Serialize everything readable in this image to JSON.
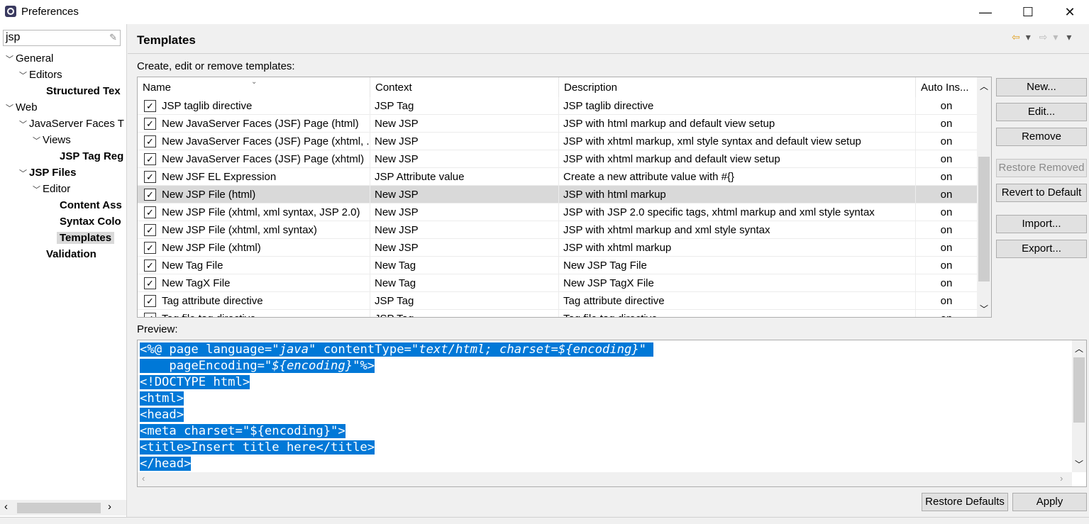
{
  "window": {
    "title": "Preferences",
    "minimize_glyph": "—",
    "maximize_glyph": "☐",
    "close_glyph": "✕"
  },
  "filter": {
    "value": "jsp",
    "clear_icon": "eraser-icon"
  },
  "tree": {
    "general": "General",
    "editors": "Editors",
    "structured_text": "Structured Tex",
    "web": "Web",
    "jsf": "JavaServer Faces T",
    "views": "Views",
    "jsp_tag_reg": "JSP Tag Reg",
    "jsp_files": "JSP Files",
    "editor": "Editor",
    "content_assist": "Content Ass",
    "syntax_coloring": "Syntax Colo",
    "templates": "Templates",
    "validation": "Validation"
  },
  "page": {
    "title": "Templates",
    "subtitle": "Create, edit or remove templates:",
    "preview_label": "Preview:"
  },
  "table": {
    "headers": {
      "name": "Name",
      "context": "Context",
      "description": "Description",
      "auto": "Auto Ins..."
    },
    "rows": [
      {
        "name": "JSP taglib directive",
        "context": "JSP Tag",
        "description": "JSP taglib directive",
        "auto": "on"
      },
      {
        "name": "New JavaServer Faces (JSF) Page (html)",
        "context": "New JSP",
        "description": "JSP with html markup and default view setup",
        "auto": "on"
      },
      {
        "name": "New JavaServer Faces (JSF) Page (xhtml, ...",
        "context": "New JSP",
        "description": "JSP with xhtml markup, xml style syntax and default view setup",
        "auto": "on"
      },
      {
        "name": "New JavaServer Faces (JSF) Page (xhtml)",
        "context": "New JSP",
        "description": "JSP with xhtml markup and default view setup",
        "auto": "on"
      },
      {
        "name": "New JSF EL Expression",
        "context": "JSP Attribute value",
        "description": "Create a new attribute value with #{}",
        "auto": "on"
      },
      {
        "name": "New JSP File (html)",
        "context": "New JSP",
        "description": "JSP with html markup",
        "auto": "on"
      },
      {
        "name": "New JSP File (xhtml, xml syntax, JSP 2.0)",
        "context": "New JSP",
        "description": "JSP with JSP 2.0 specific tags, xhtml markup and xml style syntax",
        "auto": "on"
      },
      {
        "name": "New JSP File (xhtml, xml syntax)",
        "context": "New JSP",
        "description": "JSP with xhtml markup and xml style syntax",
        "auto": "on"
      },
      {
        "name": "New JSP File (xhtml)",
        "context": "New JSP",
        "description": "JSP with xhtml markup",
        "auto": "on"
      },
      {
        "name": "New Tag File",
        "context": "New Tag",
        "description": "New JSP Tag File",
        "auto": "on"
      },
      {
        "name": "New TagX File",
        "context": "New Tag",
        "description": "New JSP TagX File",
        "auto": "on"
      },
      {
        "name": "Tag attribute directive",
        "context": "JSP Tag",
        "description": "Tag attribute directive",
        "auto": "on"
      },
      {
        "name": "Tag file tag directive",
        "context": "JSP Tag",
        "description": "Tag file tag directive",
        "auto": "on"
      }
    ]
  },
  "buttons": {
    "new": "New...",
    "edit": "Edit...",
    "remove": "Remove",
    "restore_removed": "Restore Removed",
    "revert": "Revert to Default",
    "import": "Import...",
    "export": "Export...",
    "restore_defaults": "Restore Defaults",
    "apply": "Apply"
  },
  "preview": {
    "l1a": "<%@ page language=\"",
    "l1b": "java",
    "l1c": "\" contentType=\"",
    "l1d": "text/html; charset=${encoding}",
    "l1e": "\" ",
    "l2a": "    pageEncoding=\"",
    "l2b": "${encoding}",
    "l2c": "\"%>",
    "l3": "<!DOCTYPE html>",
    "l4": "<html>",
    "l5": "<head>",
    "l6": "<meta charset=\"${encoding}\">",
    "l7": "<title>Insert title here</title>",
    "l8": "</head>"
  },
  "colors": {
    "selection": "#0078d7",
    "row_selected": "#d9d9d9"
  }
}
